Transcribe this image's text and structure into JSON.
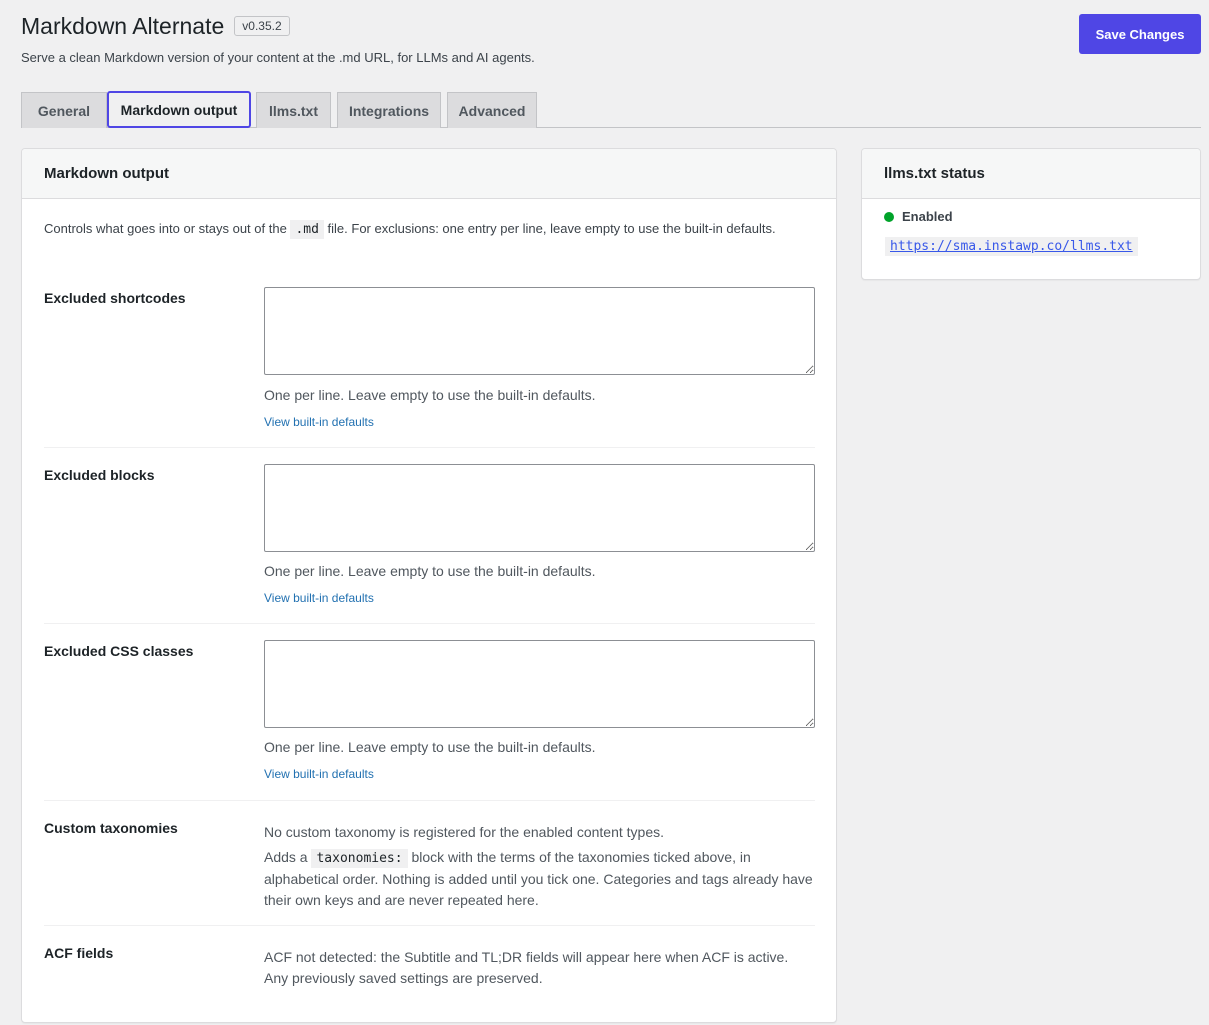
{
  "header": {
    "title": "Markdown Alternate",
    "version": "v0.35.2",
    "subtitle": "Serve a clean Markdown version of your content at the .md URL, for LLMs and AI agents."
  },
  "toolbar": {
    "save_label": "Save Changes"
  },
  "colors": {
    "accent": "#4f46e5",
    "link": "#2271b1",
    "status_enabled": "#00a32a"
  },
  "tabs": [
    {
      "label": "General",
      "active": false
    },
    {
      "label": "Markdown output",
      "active": true
    },
    {
      "label": "llms.txt",
      "active": false
    },
    {
      "label": "Integrations",
      "active": false
    },
    {
      "label": "Advanced",
      "active": false
    }
  ],
  "main": {
    "title": "Markdown output",
    "intro_before": "Controls what goes into or stays out of the",
    "intro_code": ".md",
    "intro_after": "file. For exclusions: one entry per line, leave empty to use the built-in defaults.",
    "rows": [
      {
        "label": "Excluded shortcodes",
        "value": "",
        "help": "One per line. Leave empty to use the built-in defaults.",
        "link": "View built-in defaults"
      },
      {
        "label": "Excluded blocks",
        "value": "",
        "help": "One per line. Leave empty to use the built-in defaults.",
        "link": "View built-in defaults"
      },
      {
        "label": "Excluded CSS classes",
        "value": "",
        "help": "One per line. Leave empty to use the built-in defaults.",
        "link": "View built-in defaults"
      }
    ],
    "taxonomies": {
      "label": "Custom taxonomies",
      "line1": "No custom taxonomy is registered for the enabled content types.",
      "line2_before": "Adds a",
      "line2_code": "taxonomies:",
      "line2_after": "block with the terms of the taxonomies ticked above, in alphabetical order. Nothing is added until you tick one. Categories and tags already have their own keys and are never repeated here."
    },
    "acf": {
      "label": "ACF fields",
      "text": "ACF not detected: the Subtitle and TL;DR fields will appear here when ACF is active. Any previously saved settings are preserved."
    }
  },
  "sidebar": {
    "title": "llms.txt status",
    "status": "Enabled",
    "url": "https://sma.instawp.co/llms.txt"
  }
}
